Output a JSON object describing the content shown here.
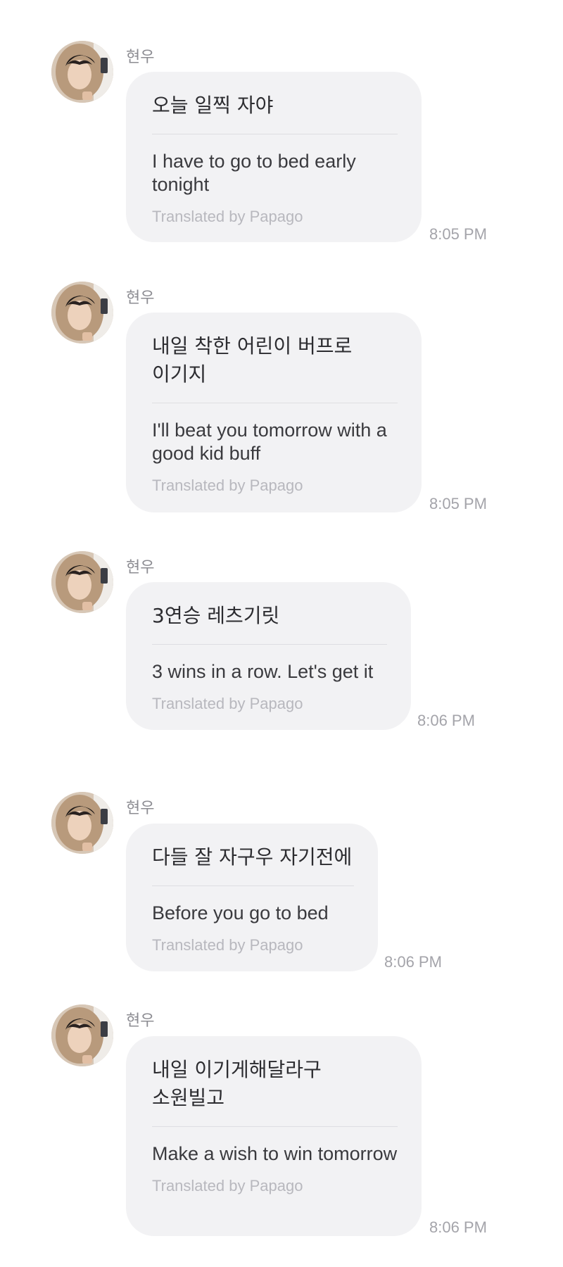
{
  "messages": [
    {
      "sender": "현우",
      "avatar_icon": "profile-photo",
      "original": "오늘 일찍 자야",
      "translation": "I have to go to bed early tonight",
      "credit": "Translated by Papago",
      "time": "8:05 PM"
    },
    {
      "sender": "현우",
      "avatar_icon": "profile-photo",
      "original": "내일 착한 어린이 버프로 이기지",
      "translation": "I'll beat you tomorrow with a good kid buff",
      "credit": "Translated by Papago",
      "time": "8:05 PM"
    },
    {
      "sender": "현우",
      "avatar_icon": "profile-photo",
      "original": "3연승 레츠기릿",
      "translation": "3 wins in a row. Let's get it",
      "credit": "Translated by Papago",
      "time": "8:06 PM"
    },
    {
      "sender": "현우",
      "avatar_icon": "profile-photo",
      "original": "다들 잘 자구우 자기전에",
      "translation": "Before you go to bed",
      "credit": "Translated by Papago",
      "time": "8:06 PM"
    },
    {
      "sender": "현우",
      "avatar_icon": "profile-photo",
      "original": "내일 이기게해달라구 소원빌고",
      "translation": "Make a wish to win tomorrow",
      "credit": "Translated by Papago",
      "time": "8:06 PM"
    }
  ]
}
